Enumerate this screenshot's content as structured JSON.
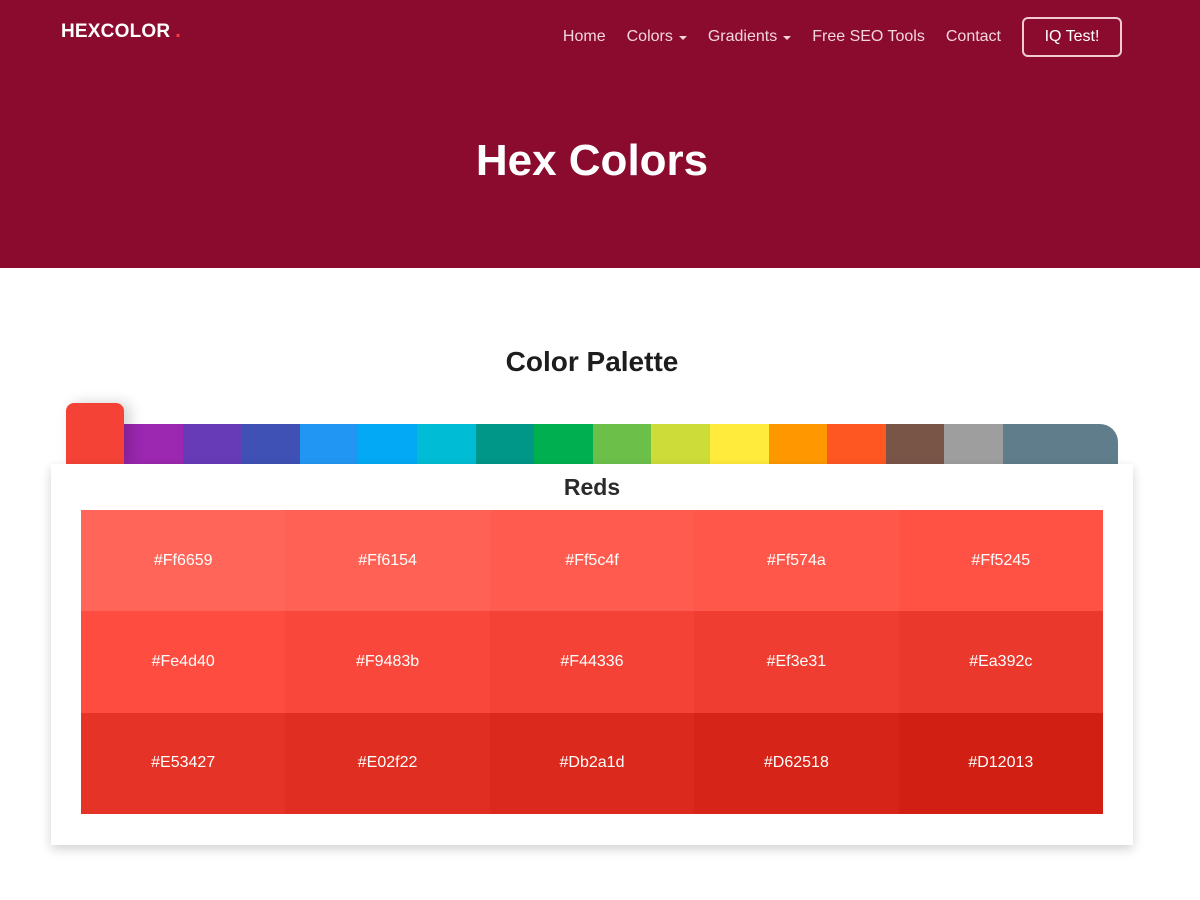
{
  "brand": {
    "logo_text": "HEXCOLOR",
    "logo_dot": ".",
    "hero_color": "#8b0b2e"
  },
  "nav": {
    "items": [
      {
        "label": "Home",
        "dropdown": false
      },
      {
        "label": "Colors",
        "dropdown": true
      },
      {
        "label": "Gradients",
        "dropdown": true
      },
      {
        "label": "Free SEO Tools",
        "dropdown": false
      },
      {
        "label": "Contact",
        "dropdown": false
      }
    ],
    "cta_label": "IQ Test!"
  },
  "hero": {
    "title": "Hex Colors"
  },
  "palette": {
    "title": "Color Palette",
    "active_tab": {
      "name": "Reds",
      "color": "#f44336"
    },
    "tabs": [
      "#e91e63",
      "#9c27b0",
      "#673ab7",
      "#3f51b5",
      "#2196f3",
      "#03a9f4",
      "#00bcd4",
      "#009688",
      "#00b050",
      "#6cc04a",
      "#cddc39",
      "#ffeb3b",
      "#ff9800",
      "#ff5722",
      "#795548",
      "#9e9e9e",
      "#607d8b"
    ],
    "group": {
      "title": "Reds",
      "swatches": [
        {
          "hex": "#Ff6659",
          "color": "#ff6659"
        },
        {
          "hex": "#Ff6154",
          "color": "#ff6154"
        },
        {
          "hex": "#Ff5c4f",
          "color": "#ff5c4f"
        },
        {
          "hex": "#Ff574a",
          "color": "#ff574a"
        },
        {
          "hex": "#Ff5245",
          "color": "#ff5245"
        },
        {
          "hex": "#Fe4d40",
          "color": "#fe4d40"
        },
        {
          "hex": "#F9483b",
          "color": "#f9483b"
        },
        {
          "hex": "#F44336",
          "color": "#f44336"
        },
        {
          "hex": "#Ef3e31",
          "color": "#ef3e31"
        },
        {
          "hex": "#Ea392c",
          "color": "#ea392c"
        },
        {
          "hex": "#E53427",
          "color": "#e53427"
        },
        {
          "hex": "#E02f22",
          "color": "#e02f22"
        },
        {
          "hex": "#Db2a1d",
          "color": "#db2a1d"
        },
        {
          "hex": "#D62518",
          "color": "#d62518"
        },
        {
          "hex": "#D12013",
          "color": "#d12013"
        }
      ]
    }
  }
}
